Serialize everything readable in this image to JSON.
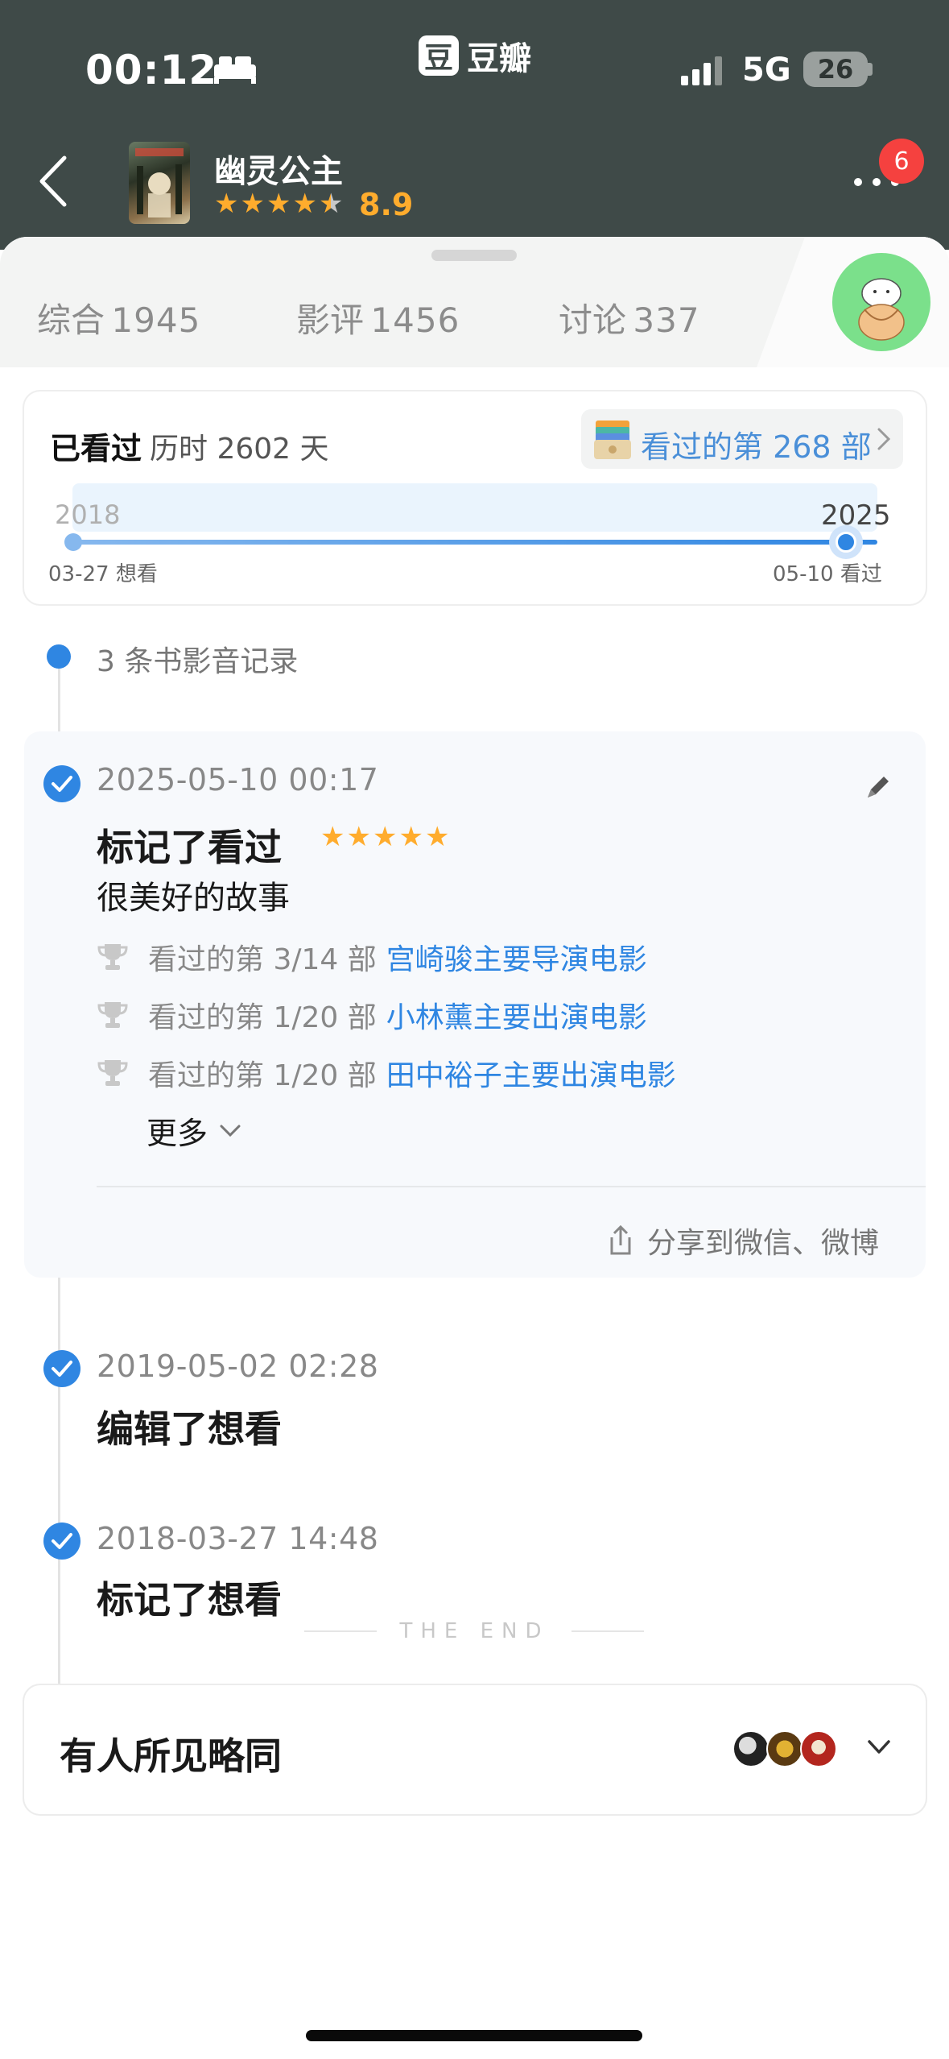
{
  "status_bar": {
    "time": "00:12",
    "app_logo_char": "豆",
    "app_name": "豆瓣",
    "network": "5G",
    "battery": "26"
  },
  "header": {
    "title": "幽灵公主",
    "rating": "8.9",
    "stars_filled": 4.5,
    "notification_count": "6"
  },
  "tabs": [
    {
      "label": "综合",
      "count": "1945"
    },
    {
      "label": "影评",
      "count": "1456"
    },
    {
      "label": "讨论",
      "count": "337"
    }
  ],
  "summary": {
    "status": "已看过",
    "duration": "历时 2602 天",
    "count_text": "看过的第 268 部",
    "year_start": "2018",
    "year_end": "2025",
    "date_start": "03-27 想看",
    "date_end": "05-10 看过"
  },
  "records": {
    "count_label": "3 条书影音记录",
    "entries": [
      {
        "date": "2025-05-10 00:17",
        "action": "标记了看过",
        "stars": 5,
        "comment": "很美好的故事",
        "achievements": [
          {
            "text": "看过的第 3/14 部",
            "link": "宫崎骏主要导演电影"
          },
          {
            "text": "看过的第 1/20 部",
            "link": "小林薰主要出演电影"
          },
          {
            "text": "看过的第 1/20 部",
            "link": "田中裕子主要出演电影"
          }
        ],
        "more_label": "更多",
        "share_label": "分享到微信、微博"
      },
      {
        "date": "2019-05-02 02:28",
        "action": "编辑了想看"
      },
      {
        "date": "2018-03-27 14:48",
        "action": "标记了想看"
      }
    ]
  },
  "agree": {
    "title": "有人所见略同"
  },
  "footer": {
    "end_text": "THE END"
  },
  "colors": {
    "header_bg": "#3f4a48",
    "accent_blue": "#2f86e2",
    "star_orange": "#ffac2d",
    "badge_red": "#f5413f"
  }
}
